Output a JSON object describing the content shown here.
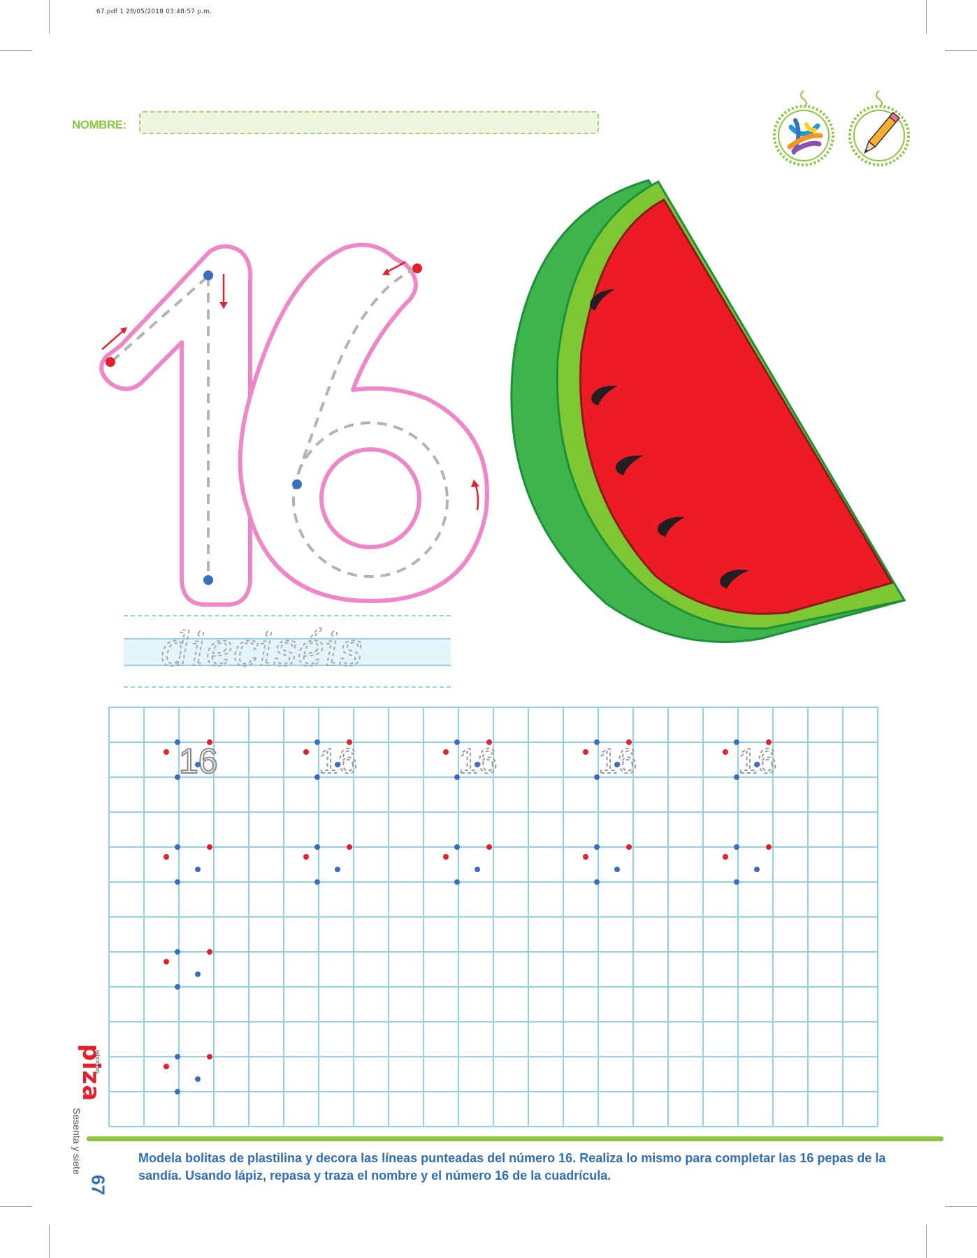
{
  "file_header": "67.pdf   1   28/05/2018   03:48:57 p.m.",
  "name_field": {
    "label": "NOMBRE:",
    "value": ""
  },
  "materials": [
    {
      "icon": "plasticine-icon",
      "meaning": ""
    },
    {
      "icon": "pencil-icon",
      "meaning": ""
    }
  ],
  "number": "16",
  "trace_word": "dieciséis",
  "grid": {
    "columns": 22,
    "rows": 12,
    "model_label": "16",
    "traced_labels": [
      "16",
      "16",
      "16",
      "16"
    ]
  },
  "instructions": "Modela bolitas de plastilina y decora las líneas punteadas del número 16. Realiza lo mismo para completar las 16 pepas de la sandía. Usando lápiz, repasa y traza el nombre y el número 16 de la cuadrícula.",
  "footer": {
    "page_number": "67",
    "page_word": "Sesenta y siete",
    "brand": "piza",
    "brand_sub": "ediciones"
  },
  "colors": {
    "accent_green": "#8cc63f",
    "text_blue": "#2f6eb5",
    "outline_pink": "#ee86c8",
    "grid_blue": "#8fd3ec",
    "dot_red": "#e4202b",
    "dot_blue": "#3a6fbf",
    "melon_red": "#ed1c24",
    "rind_dark": "#3db54a",
    "rind_light": "#7dc832"
  }
}
